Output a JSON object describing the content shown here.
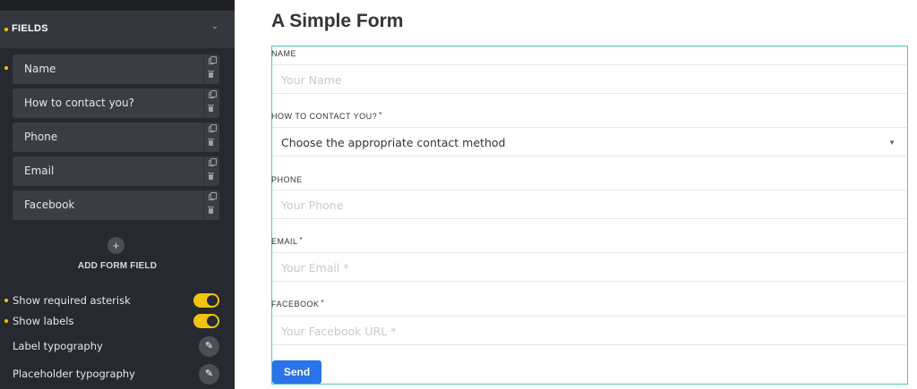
{
  "panel": {
    "section_title": "FIELDS",
    "fields": [
      {
        "label": "Name"
      },
      {
        "label": "How to contact you?"
      },
      {
        "label": "Phone"
      },
      {
        "label": "Email"
      },
      {
        "label": "Facebook"
      }
    ],
    "add_field_label": "ADD FORM FIELD",
    "add_field_icon": "+",
    "controls": {
      "show_required_asterisk": {
        "label": "Show required asterisk",
        "on": true
      },
      "show_labels": {
        "label": "Show labels",
        "on": true
      },
      "label_typography": {
        "label": "Label typography"
      },
      "placeholder_typography": {
        "label": "Placeholder typography"
      }
    },
    "accent_color": "#f1c40f"
  },
  "form": {
    "title": "A Simple Form",
    "fields": {
      "name": {
        "label": "NAME",
        "placeholder": "Your Name"
      },
      "contact": {
        "label": "HOW TO CONTACT YOU?",
        "asterisk": "*",
        "value": "Choose the appropriate contact method"
      },
      "phone": {
        "label": "PHONE",
        "placeholder": "Your Phone"
      },
      "email": {
        "label": "EMAIL",
        "asterisk": "*",
        "placeholder": "Your Email *"
      },
      "facebook": {
        "label": "FACEBOOK",
        "asterisk": "*",
        "placeholder": "Your Facebook URL *"
      }
    },
    "submit_label": "Send",
    "frame_color": "#49c9b4",
    "button_color": "#2a73e8"
  }
}
